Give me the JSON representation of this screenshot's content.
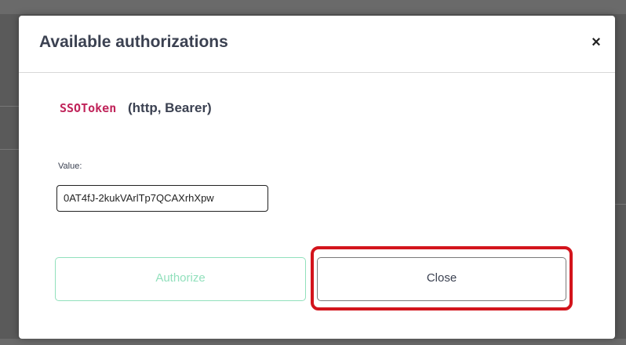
{
  "modal": {
    "title": "Available authorizations",
    "close_icon": "close-icon",
    "close_glyph": "×"
  },
  "scheme": {
    "name": "SSOToken",
    "details": "(http, Bearer)"
  },
  "value_field": {
    "label": "Value:",
    "value": "0AT4fJ-2kukVArlTp7QCAXrhXpw"
  },
  "buttons": {
    "authorize_label": "Authorize",
    "close_label": "Close"
  },
  "colors": {
    "accent_green": "#49cc90",
    "scheme_name": "#c0245a",
    "highlight_red": "#d3141c",
    "text": "#3b4151"
  }
}
